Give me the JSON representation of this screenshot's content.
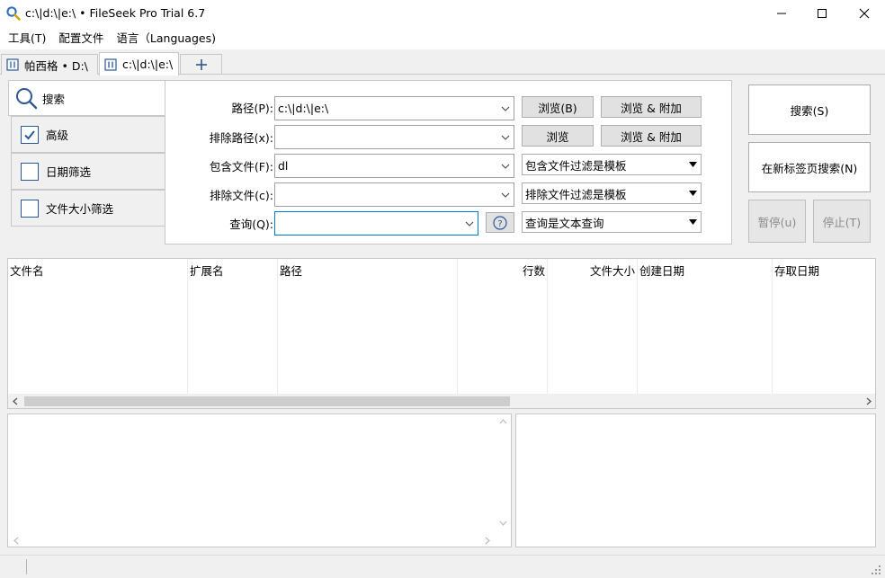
{
  "window": {
    "title": "c:\\|d:\\|e:\\ • FileSeek Pro Trial 6.7"
  },
  "menu": {
    "items": [
      "工具(T)",
      "配置文件",
      "语言（Languages)"
    ]
  },
  "tabs": {
    "items": [
      {
        "label": "帕西格 • D:\\"
      },
      {
        "label": "c:\\|d:\\|e:\\"
      }
    ],
    "add_label": "+"
  },
  "nav": {
    "search_label": "搜索",
    "advanced_label": "高级",
    "advanced_checked": true,
    "date_label": "日期筛选",
    "date_checked": false,
    "size_label": "文件大小筛选",
    "size_checked": false
  },
  "form": {
    "path_label": "路径(P):",
    "path_value": "c:\\|d:\\|e:\\",
    "exclude_path_label": "排除路径(x):",
    "exclude_path_value": "",
    "include_files_label": "包含文件(F):",
    "include_files_value": "dl",
    "exclude_files_label": "排除文件(c):",
    "exclude_files_value": "",
    "query_label": "查询(Q):",
    "query_value": "",
    "browse_b": "浏览(B)",
    "browse_add": "浏览 & 附加",
    "browse": "浏览",
    "browse_add_2": "浏览 & 附加",
    "include_mode": "包含文件过滤是模板",
    "exclude_mode": "排除文件过滤是模板",
    "query_mode": "查询是文本查询"
  },
  "actions": {
    "search": "搜索(S)",
    "search_new_tab": "在新标签页搜索(N)",
    "pause": "暂停(u)",
    "stop": "停止(T)"
  },
  "results": {
    "columns": [
      "文件名",
      "扩展名",
      "路径",
      "",
      "行数",
      "文件大小",
      "创建日期",
      "",
      "存取日期",
      ""
    ]
  }
}
